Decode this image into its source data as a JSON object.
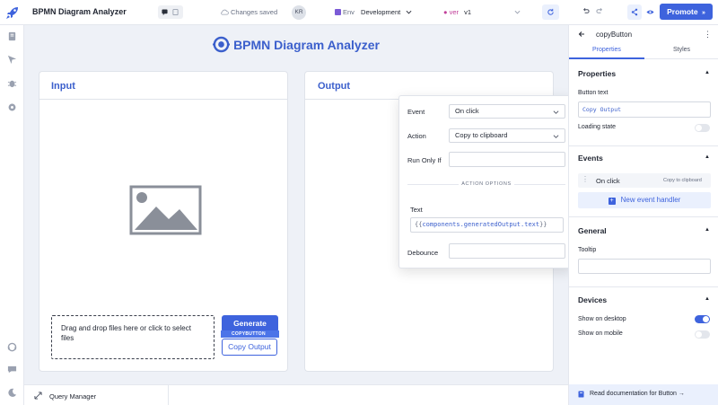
{
  "topbar": {
    "app_title": "BPMN Diagram Analyzer",
    "saved_status": "Changes saved",
    "avatar_initials": "KR",
    "env_tag": "Env",
    "env_name": "Development",
    "version_tag": "ver",
    "version_name": "v1",
    "promote_label": "Promote"
  },
  "canvas": {
    "header_title": "BPMN Diagram Analyzer",
    "input_card": {
      "title": "Input",
      "dropzone_text": "Drag and drop files here or click to select files",
      "generate_label": "Generate",
      "copy_tag": "COPYBUTTON",
      "copy_label": "Copy Output"
    },
    "output_card": {
      "title": "Output"
    }
  },
  "event_popover": {
    "event_label": "Event",
    "event_value": "On click",
    "action_label": "Action",
    "action_value": "Copy to clipboard",
    "run_only_if_label": "Run Only If",
    "run_only_if_value": "",
    "action_options_heading": "ACTION OPTIONS",
    "text_label": "Text",
    "text_open": "{{",
    "text_value": "components.generatedOutput.text",
    "text_close": "}}",
    "debounce_label": "Debounce",
    "debounce_value": ""
  },
  "bottombar": {
    "query_manager_label": "Query Manager"
  },
  "inspector": {
    "component_name": "copyButton",
    "tabs": [
      "Properties",
      "Styles"
    ],
    "properties_title": "Properties",
    "button_text_label": "Button text",
    "button_text_value": "Copy Output",
    "loading_state_label": "Loading state",
    "loading_state_on": false,
    "events_title": "Events",
    "event_row_event": "On click",
    "event_row_action": "Copy to clipboard",
    "new_event_label": "New event handler",
    "general_title": "General",
    "tooltip_label": "Tooltip",
    "tooltip_value": "",
    "devices_title": "Devices",
    "show_desktop_label": "Show on desktop",
    "show_desktop_on": true,
    "show_mobile_label": "Show on mobile",
    "show_mobile_on": false,
    "docs_label": "Read documentation for Button →"
  },
  "icons": {
    "logo": "rocket-icon",
    "rail": [
      "pages-icon",
      "inspector-icon",
      "debugger-icon",
      "settings-icon",
      "support-icon",
      "chat-icon",
      "darkmode-icon"
    ]
  },
  "colors": {
    "primary": "#3e63dd",
    "heading": "#3b5fcc",
    "canvas_bg": "#eef1f7"
  }
}
